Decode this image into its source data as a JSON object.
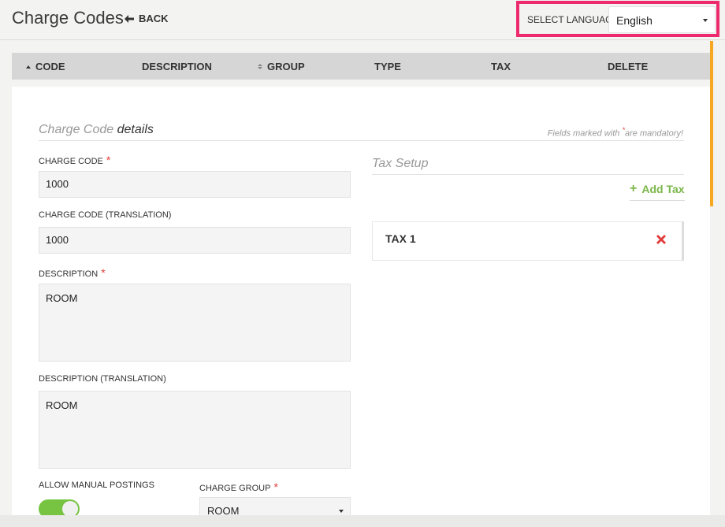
{
  "header": {
    "title": "Charge Codes",
    "back_label": "BACK",
    "language": {
      "label": "SELECT LANGUAGE",
      "selected": "English"
    }
  },
  "table": {
    "columns": [
      "CODE",
      "DESCRIPTION",
      "GROUP",
      "TYPE",
      "TAX",
      "DELETE"
    ]
  },
  "details": {
    "title_prefix": "Charge Code",
    "title_emph": "details",
    "mandatory_note_pre": "Fields marked with",
    "mandatory_star": "*",
    "mandatory_note_post": "are mandatory!",
    "fields": {
      "charge_code": {
        "label": "CHARGE CODE",
        "value": "1000"
      },
      "charge_code_translation": {
        "label": "CHARGE CODE (TRANSLATION)",
        "value": "1000"
      },
      "description": {
        "label": "DESCRIPTION",
        "value": "ROOM"
      },
      "description_translation": {
        "label": "DESCRIPTION (TRANSLATION)",
        "value": "ROOM"
      },
      "allow_manual_postings": {
        "label": "ALLOW MANUAL POSTINGS",
        "on": true
      },
      "charge_group": {
        "label": "CHARGE GROUP",
        "value": "ROOM"
      }
    },
    "required_star": "*"
  },
  "tax_setup": {
    "title": "Tax Setup",
    "add_label": "Add Tax",
    "taxes": [
      {
        "name": "TAX 1"
      }
    ]
  },
  "colors": {
    "highlight": "#ee2a6e",
    "accent_green": "#76c442",
    "delete_red": "#e23b3b",
    "scroll_accent": "#f7a823"
  }
}
